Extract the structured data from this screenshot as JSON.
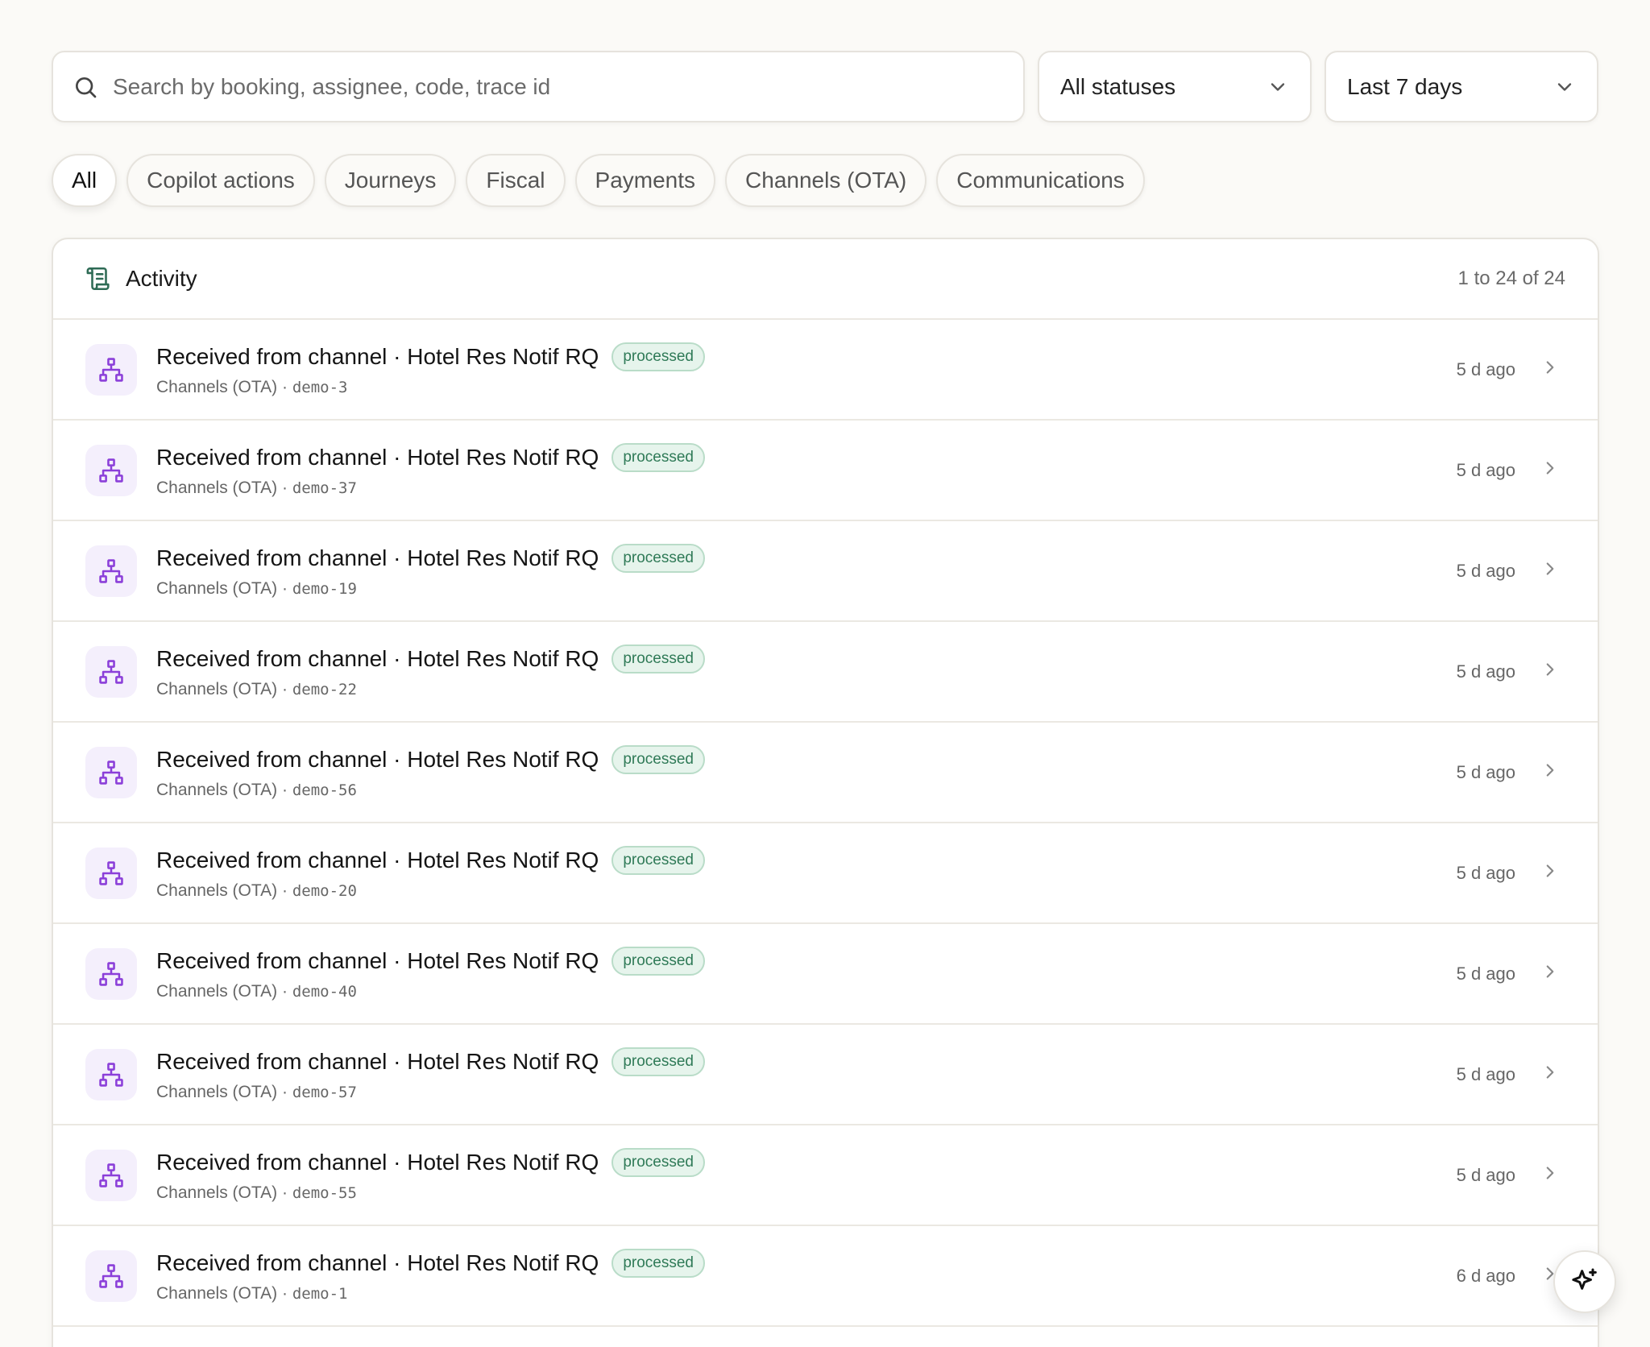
{
  "search": {
    "placeholder": "Search by booking, assignee, code, trace id"
  },
  "status_filter": {
    "selected": "All statuses"
  },
  "date_filter": {
    "selected": "Last 7 days"
  },
  "categories": [
    {
      "label": "All",
      "active": true
    },
    {
      "label": "Copilot actions",
      "active": false
    },
    {
      "label": "Journeys",
      "active": false
    },
    {
      "label": "Fiscal",
      "active": false
    },
    {
      "label": "Payments",
      "active": false
    },
    {
      "label": "Channels (OTA)",
      "active": false
    },
    {
      "label": "Communications",
      "active": false
    }
  ],
  "activity": {
    "title": "Activity",
    "count_text": "1 to 24 of 24",
    "rows": [
      {
        "title": "Received from channel · Hotel Res Notif RQ",
        "status": "processed",
        "category": "Channels (OTA)",
        "ref": "demo-3",
        "time": "5 d ago"
      },
      {
        "title": "Received from channel · Hotel Res Notif RQ",
        "status": "processed",
        "category": "Channels (OTA)",
        "ref": "demo-37",
        "time": "5 d ago"
      },
      {
        "title": "Received from channel · Hotel Res Notif RQ",
        "status": "processed",
        "category": "Channels (OTA)",
        "ref": "demo-19",
        "time": "5 d ago"
      },
      {
        "title": "Received from channel · Hotel Res Notif RQ",
        "status": "processed",
        "category": "Channels (OTA)",
        "ref": "demo-22",
        "time": "5 d ago"
      },
      {
        "title": "Received from channel · Hotel Res Notif RQ",
        "status": "processed",
        "category": "Channels (OTA)",
        "ref": "demo-56",
        "time": "5 d ago"
      },
      {
        "title": "Received from channel · Hotel Res Notif RQ",
        "status": "processed",
        "category": "Channels (OTA)",
        "ref": "demo-20",
        "time": "5 d ago"
      },
      {
        "title": "Received from channel · Hotel Res Notif RQ",
        "status": "processed",
        "category": "Channels (OTA)",
        "ref": "demo-40",
        "time": "5 d ago"
      },
      {
        "title": "Received from channel · Hotel Res Notif RQ",
        "status": "processed",
        "category": "Channels (OTA)",
        "ref": "demo-57",
        "time": "5 d ago"
      },
      {
        "title": "Received from channel · Hotel Res Notif RQ",
        "status": "processed",
        "category": "Channels (OTA)",
        "ref": "demo-55",
        "time": "5 d ago"
      },
      {
        "title": "Received from channel · Hotel Res Notif RQ",
        "status": "processed",
        "category": "Channels (OTA)",
        "ref": "demo-1",
        "time": "6 d ago"
      }
    ]
  },
  "separator": " · ",
  "icons": {
    "search": "search-icon",
    "chevron_down": "chevron-down-icon",
    "activity": "scroll-list-icon",
    "row": "network-hierarchy-icon",
    "row_arrow": "chevron-right-icon",
    "copilot": "sparkles-icon"
  },
  "colors": {
    "background": "#fbfaf7",
    "accent_purple": "#8b3fd9",
    "status_green": "#2f7a57",
    "header_icon_green": "#2e6b55"
  }
}
